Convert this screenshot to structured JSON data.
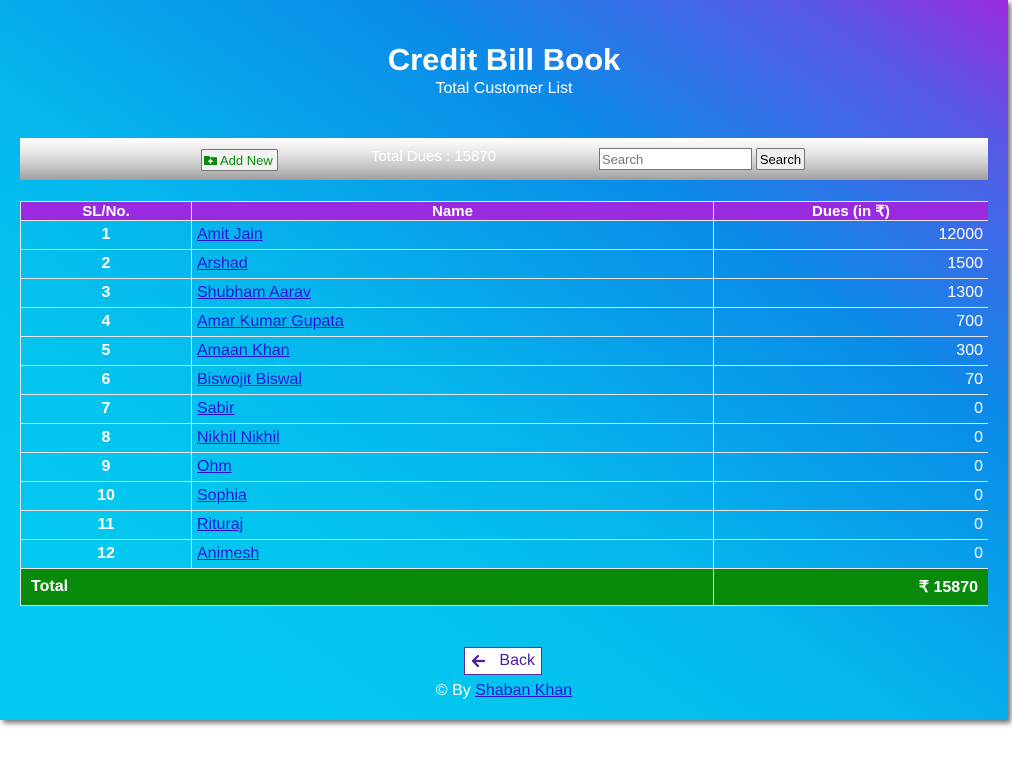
{
  "header": {
    "title": "Credit Bill Book",
    "subtitle": "Total Customer List"
  },
  "toolbar": {
    "add_label": "Add New",
    "total_dues_text": "Total Dues : 15870",
    "search_placeholder": "Search",
    "search_label": "Search"
  },
  "table": {
    "headers": [
      "SL/No.",
      "Name",
      "Dues (in ₹)"
    ],
    "rows": [
      {
        "sl": "1",
        "name": "Amit Jain",
        "dues": "12000"
      },
      {
        "sl": "2",
        "name": "Arshad",
        "dues": "1500"
      },
      {
        "sl": "3",
        "name": "Shubham Aarav",
        "dues": "1300"
      },
      {
        "sl": "4",
        "name": "Amar Kumar Gupata",
        "dues": "700"
      },
      {
        "sl": "5",
        "name": "Amaan Khan",
        "dues": "300"
      },
      {
        "sl": "6",
        "name": "Biswojit Biswal",
        "dues": "70"
      },
      {
        "sl": "7",
        "name": "Sabir",
        "dues": "0"
      },
      {
        "sl": "8",
        "name": "Nikhil Nikhil",
        "dues": "0"
      },
      {
        "sl": "9",
        "name": "Ohm",
        "dues": "0"
      },
      {
        "sl": "10",
        "name": "Sophia",
        "dues": "0"
      },
      {
        "sl": "11",
        "name": "Rituraj",
        "dues": "0"
      },
      {
        "sl": "12",
        "name": "Animesh",
        "dues": "0"
      }
    ],
    "total_label": "Total",
    "total_amount": "₹ 15870"
  },
  "footer": {
    "back_label": "Back",
    "copyright_prefix": "© By",
    "author": "Shaban Khan"
  },
  "colors": {
    "accent": "#9a2ae0",
    "total_row": "#0a8a0a",
    "link": "#2a14d8"
  },
  "icons": {
    "add": "folder-plus-icon",
    "back": "arrow-left-icon"
  }
}
